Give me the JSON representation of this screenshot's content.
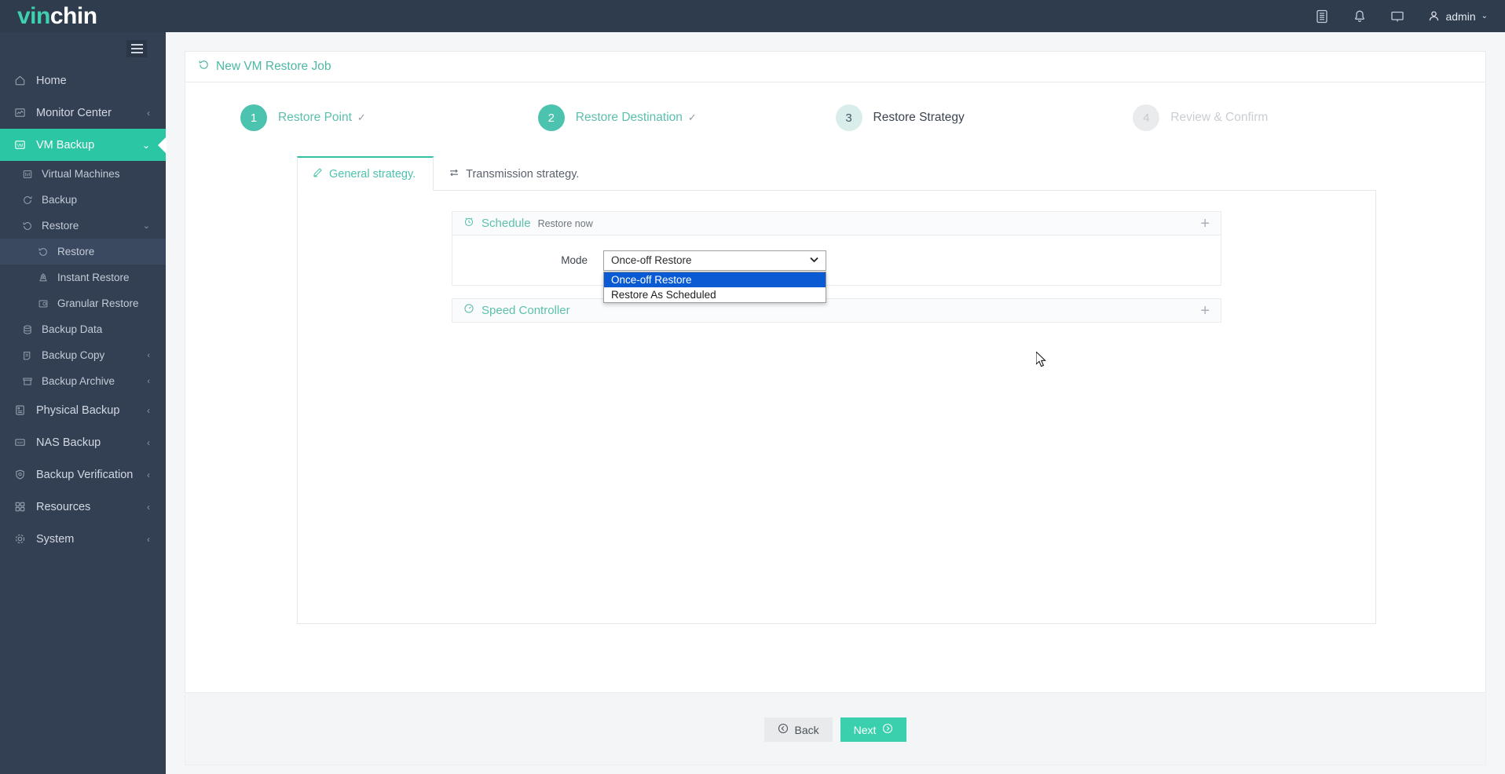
{
  "brand": {
    "part_a": "vin",
    "part_b": "chin"
  },
  "topbar": {
    "icons": [
      "document-icon",
      "bell-icon",
      "monitor-icon"
    ],
    "user": "admin",
    "caret": "⌄"
  },
  "sidebar": {
    "items": [
      {
        "label": "Home",
        "icon": "home-icon",
        "level": 1,
        "arrow": "",
        "state": "normal"
      },
      {
        "label": "Monitor Center",
        "icon": "monitor-chart-icon",
        "level": 1,
        "arrow": "‹",
        "state": "normal"
      },
      {
        "label": "VM Backup",
        "icon": "vm-icon",
        "level": 1,
        "arrow": "⌄",
        "state": "active"
      },
      {
        "label": "Virtual Machines",
        "icon": "server-icon",
        "level": 2,
        "arrow": "",
        "state": "normal"
      },
      {
        "label": "Backup",
        "icon": "backup-icon",
        "level": 2,
        "arrow": "",
        "state": "normal"
      },
      {
        "label": "Restore",
        "icon": "restore-icon",
        "level": 2,
        "arrow": "⌄",
        "state": "normal"
      },
      {
        "label": "Restore",
        "icon": "restore-icon",
        "level": 3,
        "arrow": "",
        "state": "selected"
      },
      {
        "label": "Instant Restore",
        "icon": "rocket-icon",
        "level": 3,
        "arrow": "",
        "state": "normal"
      },
      {
        "label": "Granular Restore",
        "icon": "granular-icon",
        "level": 3,
        "arrow": "",
        "state": "normal"
      },
      {
        "label": "Backup Data",
        "icon": "database-icon",
        "level": 2,
        "arrow": "",
        "state": "normal"
      },
      {
        "label": "Backup Copy",
        "icon": "copy-icon",
        "level": 2,
        "arrow": "‹",
        "state": "normal"
      },
      {
        "label": "Backup Archive",
        "icon": "archive-icon",
        "level": 2,
        "arrow": "‹",
        "state": "normal"
      },
      {
        "label": "Physical Backup",
        "icon": "physical-server-icon",
        "level": 1,
        "arrow": "‹",
        "state": "normal"
      },
      {
        "label": "NAS Backup",
        "icon": "nas-icon",
        "level": 1,
        "arrow": "‹",
        "state": "normal"
      },
      {
        "label": "Backup Verification",
        "icon": "shield-check-icon",
        "level": 1,
        "arrow": "‹",
        "state": "normal"
      },
      {
        "label": "Resources",
        "icon": "grid-icon",
        "level": 1,
        "arrow": "‹",
        "state": "normal"
      },
      {
        "label": "System",
        "icon": "gear-icon",
        "level": 1,
        "arrow": "‹",
        "state": "normal"
      }
    ]
  },
  "page": {
    "title": "New VM Restore Job",
    "title_icon": "restore-icon"
  },
  "steps": [
    {
      "num": "1",
      "label": "Restore Point",
      "check": "✓",
      "state": "done"
    },
    {
      "num": "2",
      "label": "Restore Destination",
      "check": "✓",
      "state": "done"
    },
    {
      "num": "3",
      "label": "Restore Strategy",
      "check": "",
      "state": "current"
    },
    {
      "num": "4",
      "label": "Review & Confirm",
      "check": "",
      "state": "todo"
    }
  ],
  "tabs": [
    {
      "label": "General strategy.",
      "icon": "pencil-icon",
      "active": true
    },
    {
      "label": "Transmission strategy.",
      "icon": "transfer-icon",
      "active": false
    }
  ],
  "sections": {
    "schedule": {
      "title": "Schedule",
      "subtitle": "Restore now",
      "icon": "alarm-clock-icon",
      "plus": "+",
      "field_label": "Mode",
      "select": {
        "value": "Once-off Restore",
        "caret": "⌄",
        "open": true,
        "options": [
          {
            "label": "Once-off Restore",
            "selected": true
          },
          {
            "label": "Restore As Scheduled",
            "selected": false
          }
        ]
      }
    },
    "speed": {
      "title": "Speed Controller",
      "icon": "gauge-icon",
      "plus": "+"
    }
  },
  "footer": {
    "back_label": "Back",
    "next_label": "Next"
  },
  "colors": {
    "accent_teal": "#3ad0ad",
    "sidebar_bg": "#333f52",
    "topbar_bg": "#2f3c4e",
    "select_highlight": "#0a5bd3"
  }
}
